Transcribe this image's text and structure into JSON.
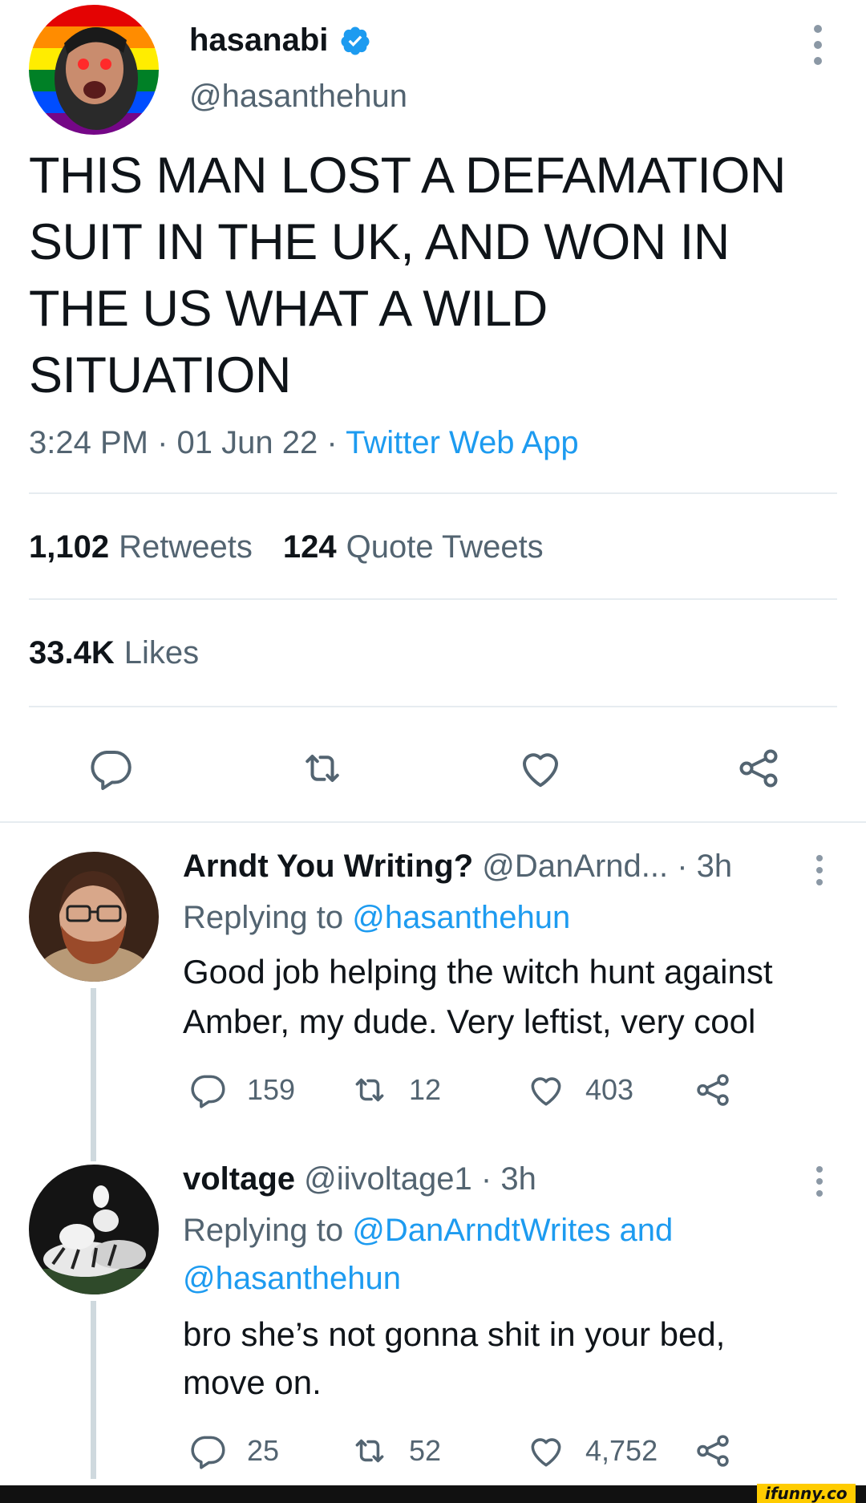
{
  "main_tweet": {
    "display_name": "hasanabi",
    "handle": "@hasanthehun",
    "text_lines": [
      "THIS MAN LOST A DEFAMATION",
      "SUIT IN THE UK, AND WON IN",
      "THE US WHAT A WILD",
      "SITUATION"
    ],
    "time": "3:24 PM",
    "date": "01 Jun 22",
    "source": "Twitter Web App",
    "separator": "·",
    "retweets_count": "1,102",
    "retweets_label": "Retweets",
    "quote_count": "124",
    "quote_label": "Quote Tweets",
    "likes_count": "33.4K",
    "likes_label": "Likes",
    "actions": [
      "reply-icon",
      "retweet-icon",
      "like-icon",
      "share-icon"
    ]
  },
  "replies": [
    {
      "display_name": "Arndt You Writing?",
      "handle": "@DanArnd...",
      "time": "· 3h",
      "replying_prefix": "Replying to",
      "replying_to_line1": "@hasanthehun",
      "replying_to_line2": "",
      "body_lines": [
        "Good job helping the witch hunt against",
        "Amber, my dude. Very leftist, very cool"
      ],
      "replies": "159",
      "retweets": "12",
      "likes": "403"
    },
    {
      "display_name": "voltage",
      "handle": "@iivoltage1",
      "time": "· 3h",
      "replying_prefix": "Replying to",
      "replying_to_line1": "@DanArndtWrites and",
      "replying_to_line2": "@hasanthehun",
      "body_lines": [
        "bro she’s not gonna shit in your bed,",
        "move on."
      ],
      "replies": "25",
      "retweets": "52",
      "likes": "4,752"
    }
  ],
  "watermark": "ifunny.co",
  "colors": {
    "text": "#0f1419",
    "muted": "#536471",
    "link": "#1d9bf0",
    "divider": "#e6ecf0",
    "verified": "#1d9bf0"
  }
}
